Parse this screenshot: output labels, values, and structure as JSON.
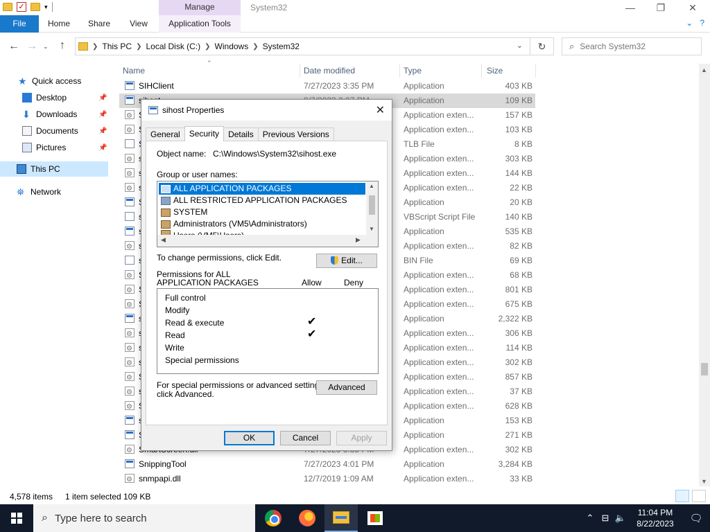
{
  "window": {
    "title": "System32",
    "manage_tab": "Manage",
    "minimize": "—",
    "maximize": "❐",
    "close": "✕"
  },
  "ribbon": {
    "tabs": [
      "File",
      "Home",
      "Share",
      "View",
      "Application Tools"
    ],
    "expand": "⌄",
    "help": "?"
  },
  "address": {
    "crumbs": [
      "This PC",
      "Local Disk (C:)",
      "Windows",
      "System32"
    ],
    "search_placeholder": "Search System32"
  },
  "nav": {
    "quick_access": "Quick access",
    "items": [
      "Desktop",
      "Downloads",
      "Documents",
      "Pictures"
    ],
    "this_pc": "This PC",
    "network": "Network"
  },
  "columns": {
    "name": "Name",
    "date": "Date modified",
    "type": "Type",
    "size": "Size"
  },
  "files": [
    {
      "name": "SIHClient",
      "date": "7/27/2023 3:35 PM",
      "type": "Application",
      "size": "403 KB",
      "icon": "app"
    },
    {
      "name": "sihost",
      "date": "8/7/2023 2:07 PM",
      "type": "Application",
      "size": "109 KB",
      "icon": "app",
      "selected": true
    },
    {
      "name": "S",
      "date": "",
      "type": "Application exten...",
      "size": "157 KB",
      "icon": "dll"
    },
    {
      "name": "S",
      "date": "",
      "type": "Application exten...",
      "size": "103 KB",
      "icon": "dll"
    },
    {
      "name": "S",
      "date": "",
      "type": "TLB File",
      "size": "8 KB",
      "icon": "file"
    },
    {
      "name": "s",
      "date": "",
      "type": "Application exten...",
      "size": "303 KB",
      "icon": "dll"
    },
    {
      "name": "s",
      "date": "",
      "type": "Application exten...",
      "size": "144 KB",
      "icon": "dll"
    },
    {
      "name": "s",
      "date": "",
      "type": "Application exten...",
      "size": "22 KB",
      "icon": "dll"
    },
    {
      "name": "S",
      "date": "",
      "type": "Application",
      "size": "20 KB",
      "icon": "app"
    },
    {
      "name": "s",
      "date": "",
      "type": "VBScript Script File",
      "size": "140 KB",
      "icon": "vbs"
    },
    {
      "name": "s",
      "date": "",
      "type": "Application",
      "size": "535 KB",
      "icon": "app"
    },
    {
      "name": "s",
      "date": "",
      "type": "Application exten...",
      "size": "82 KB",
      "icon": "dll"
    },
    {
      "name": "s",
      "date": "",
      "type": "BIN File",
      "size": "69 KB",
      "icon": "file"
    },
    {
      "name": "S",
      "date": "",
      "type": "Application exten...",
      "size": "68 KB",
      "icon": "dll"
    },
    {
      "name": "S",
      "date": "",
      "type": "Application exten...",
      "size": "801 KB",
      "icon": "dll"
    },
    {
      "name": "S",
      "date": "",
      "type": "Application exten...",
      "size": "675 KB",
      "icon": "dll"
    },
    {
      "name": "s",
      "date": "",
      "type": "Application",
      "size": "2,322 KB",
      "icon": "app"
    },
    {
      "name": "s",
      "date": "",
      "type": "Application exten...",
      "size": "306 KB",
      "icon": "dll"
    },
    {
      "name": "s",
      "date": "",
      "type": "Application exten...",
      "size": "114 KB",
      "icon": "dll"
    },
    {
      "name": "s",
      "date": "",
      "type": "Application exten...",
      "size": "302 KB",
      "icon": "dll"
    },
    {
      "name": "S",
      "date": "",
      "type": "Application exten...",
      "size": "857 KB",
      "icon": "dll"
    },
    {
      "name": "s",
      "date": "",
      "type": "Application exten...",
      "size": "37 KB",
      "icon": "dll"
    },
    {
      "name": "S",
      "date": "",
      "type": "Application exten...",
      "size": "628 KB",
      "icon": "dll"
    },
    {
      "name": "s",
      "date": "",
      "type": "Application",
      "size": "153 KB",
      "icon": "app"
    },
    {
      "name": "S",
      "date": "",
      "type": "Application",
      "size": "271 KB",
      "icon": "app"
    },
    {
      "name": "SmartScreen.dll",
      "date": "7/27/2023 3:35 PM",
      "type": "Application exten...",
      "size": "302 KB",
      "icon": "dll"
    },
    {
      "name": "SnippingTool",
      "date": "7/27/2023 4:01 PM",
      "type": "Application",
      "size": "3,284 KB",
      "icon": "app"
    },
    {
      "name": "snmpapi.dll",
      "date": "12/7/2019 1:09 AM",
      "type": "Application exten...",
      "size": "33 KB",
      "icon": "dll"
    }
  ],
  "status": {
    "count": "4,578 items",
    "selected": "1 item selected  109 KB"
  },
  "taskbar": {
    "search_placeholder": "Type here to search",
    "time": "11:04 PM",
    "date": "8/22/2023"
  },
  "dialog": {
    "title": "sihost Properties",
    "close": "✕",
    "tabs": [
      "General",
      "Security",
      "Details",
      "Previous Versions"
    ],
    "active_tab": "Security",
    "object_label": "Object name:",
    "object_value": "C:\\Windows\\System32\\sihost.exe",
    "groups_label": "Group or user names:",
    "groups": [
      "ALL APPLICATION PACKAGES",
      "ALL RESTRICTED APPLICATION PACKAGES",
      "SYSTEM",
      "Administrators (VM5\\Administrators)",
      "Users (VM5\\Users)"
    ],
    "change_text": "To change permissions, click Edit.",
    "edit_button": "Edit...",
    "perm_for_line1": "Permissions for ALL",
    "perm_for_line2": "APPLICATION PACKAGES",
    "allow": "Allow",
    "deny": "Deny",
    "permissions": [
      {
        "name": "Full control",
        "allow": false
      },
      {
        "name": "Modify",
        "allow": false
      },
      {
        "name": "Read & execute",
        "allow": true
      },
      {
        "name": "Read",
        "allow": true
      },
      {
        "name": "Write",
        "allow": false
      },
      {
        "name": "Special permissions",
        "allow": false
      }
    ],
    "special_line1": "For special permissions or advanced settings,",
    "special_line2": "click Advanced.",
    "advanced_button": "Advanced",
    "ok": "OK",
    "cancel": "Cancel",
    "apply": "Apply"
  }
}
